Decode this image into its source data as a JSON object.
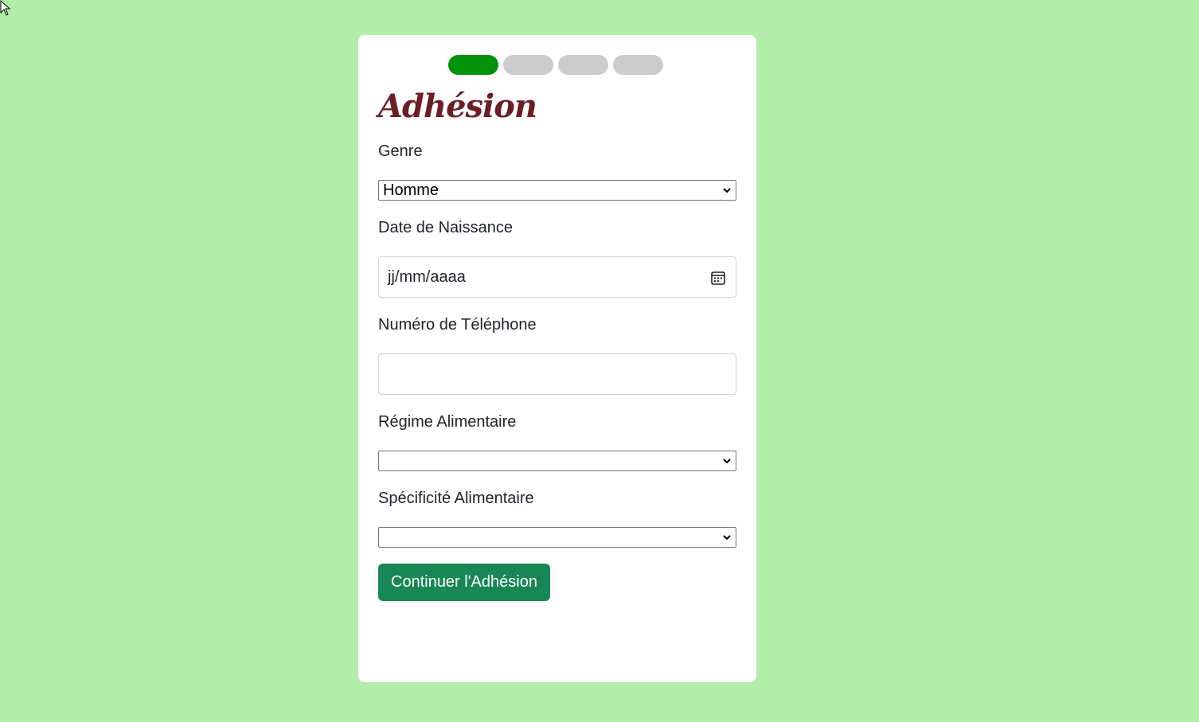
{
  "progress": {
    "total_steps": 4,
    "current_step": 1
  },
  "form": {
    "title": "Adhésion",
    "genre_label": "Genre",
    "genre_value": "Homme",
    "birthdate_label": "Date de Naissance",
    "birthdate_placeholder": "jj/mm/aaaa",
    "phone_label": "Numéro de Téléphone",
    "phone_value": "",
    "diet_label": "Régime Alimentaire",
    "diet_value": "",
    "diet_specific_label": "Spécificité Alimentaire",
    "diet_specific_value": "",
    "submit_label": "Continuer l'Adhésion"
  },
  "colors": {
    "background": "#b2eda9",
    "progress_active": "#009208",
    "progress_inactive": "#cccccc",
    "title": "#6b1e24",
    "button": "#198754"
  },
  "icons": {
    "mouse_cursor": "mouse-cursor-icon",
    "calendar": "calendar-icon",
    "dropdown": "chevron-down-icon"
  }
}
